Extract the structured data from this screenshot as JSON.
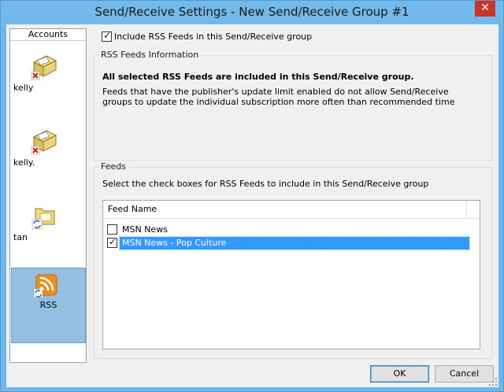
{
  "window": {
    "title": "Send/Receive Settings - New Send/Receive Group #1",
    "close_glyph": "✕"
  },
  "accounts": {
    "header": "Accounts",
    "items": [
      {
        "label": "kelly",
        "icon": "mail-account-error-icon"
      },
      {
        "label": "kelly.",
        "icon": "mail-account-error-icon"
      },
      {
        "label": "tan",
        "icon": "folder-sync-icon"
      },
      {
        "label": "RSS",
        "icon": "rss-sync-icon",
        "selected": true
      }
    ]
  },
  "include": {
    "checked": true,
    "label": "Include RSS Feeds in this Send/Receive group"
  },
  "info": {
    "title": "RSS Feeds Information",
    "bold": "All selected RSS Feeds are included in this Send/Receive group.",
    "text": "Feeds that have the publisher's update limit enabled do not allow Send/Receive groups to update the individual subscription more often than recommended time"
  },
  "feeds": {
    "title": "Feeds",
    "instructions": "Select the check boxes for RSS Feeds to include in this Send/Receive group",
    "column": "Feed Name",
    "rows": [
      {
        "name": "MSN News",
        "checked": false
      },
      {
        "name": "MSN News - Pop Culture",
        "checked": true,
        "selected": true
      }
    ]
  },
  "buttons": {
    "ok": "OK",
    "cancel": "Cancel"
  },
  "colors": {
    "titlebar": "#73b9ea",
    "selection": "#3399ff",
    "account_selected": "#94bfe0",
    "rss_orange": "#f08c1e"
  }
}
